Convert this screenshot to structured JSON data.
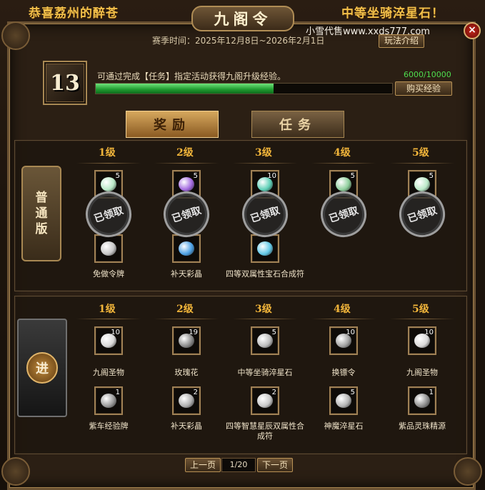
{
  "banner": {
    "left_text": "恭喜荔州的醉苍",
    "right_text": "中等坐骑淬星石！"
  },
  "window": {
    "title": "九阁令",
    "season_label": "赛季时间：",
    "season_range": "2025年12月8日~2026年2月1日",
    "watermark": "小雪代售www.xxds777.com",
    "rules_button": "玩法介绍",
    "close_icon": "×"
  },
  "progress": {
    "level": "13",
    "description": "可通过完成【任务】指定活动获得九阁升级经验。",
    "exp_text": "6000/10000",
    "exp_fraction": 0.6,
    "buy_exp_button": "购买经验"
  },
  "tabs": [
    {
      "label": "奖励",
      "active": true
    },
    {
      "label": "任务",
      "active": false
    }
  ],
  "claimed_stamp": "已领取",
  "normal_track": {
    "badge": "普通版",
    "levels": [
      {
        "label": "1级",
        "top": {
          "count": "5",
          "color": "#b9e8c7",
          "claimed": true
        },
        "bottom": {
          "count": "",
          "color": "#c7c7c7",
          "claimed": false
        },
        "name": "免做令牌"
      },
      {
        "label": "2级",
        "top": {
          "count": "5",
          "color": "#a46be0",
          "claimed": true
        },
        "bottom": {
          "count": "",
          "color": "#4ea2e6",
          "claimed": false
        },
        "name": "补天彩晶"
      },
      {
        "label": "3级",
        "top": {
          "count": "10",
          "color": "#5fd0b8",
          "claimed": true
        },
        "bottom": {
          "count": "",
          "color": "#63c9e8",
          "claimed": false
        },
        "name": "四等双属性宝石合成符"
      },
      {
        "label": "4级",
        "top": {
          "count": "5",
          "color": "#8fcf9d",
          "claimed": true
        },
        "bottom": null,
        "name": ""
      },
      {
        "label": "5级",
        "top": {
          "count": "5",
          "color": "#b9e8c7",
          "claimed": true
        },
        "bottom": null,
        "name": ""
      }
    ]
  },
  "advanced_track": {
    "badge": "进",
    "levels": [
      {
        "label": "1级",
        "top": {
          "count": "10",
          "color": "#d9d9d9"
        },
        "top_name": "九阁圣物",
        "bottom": {
          "count": "1",
          "color": "#9a9a9a"
        },
        "bottom_name": "紫车经验牌"
      },
      {
        "label": "2级",
        "top": {
          "count": "19",
          "color": "#8c8c8c"
        },
        "top_name": "玫瑰花",
        "bottom": {
          "count": "2",
          "color": "#b0b0b0"
        },
        "bottom_name": "补天彩晶"
      },
      {
        "label": "3级",
        "top": {
          "count": "5",
          "color": "#bdbdbd"
        },
        "top_name": "中等坐骑淬星石",
        "bottom": {
          "count": "2",
          "color": "#c9c9c9"
        },
        "bottom_name": "四等智慧星辰双属性合成符"
      },
      {
        "label": "4级",
        "top": {
          "count": "10",
          "color": "#a3a3a3"
        },
        "top_name": "换镖令",
        "bottom": {
          "count": "5",
          "color": "#b5b5b5"
        },
        "bottom_name": "神魔淬星石"
      },
      {
        "label": "5级",
        "top": {
          "count": "10",
          "color": "#d9d9d9"
        },
        "top_name": "九阁圣物",
        "bottom": {
          "count": "1",
          "color": "#8f8f8f"
        },
        "bottom_name": "紫品灵珠精源"
      }
    ]
  },
  "pager": {
    "prev": "上一页",
    "page": "1/20",
    "next": "下一页"
  }
}
